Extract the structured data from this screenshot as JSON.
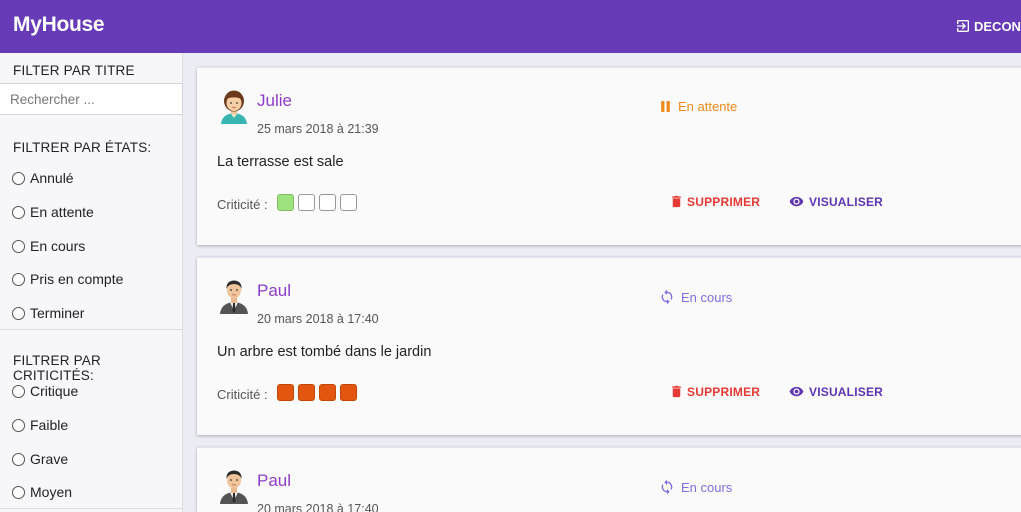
{
  "app": {
    "title": "MyHouse",
    "logout_label": "DECONNEXION"
  },
  "sidebar": {
    "filter_title_heading": "FILTER PAR TITRE",
    "search_placeholder": "Rechercher ...",
    "filter_states_heading": "FILTRER PAR ÉTATS:",
    "states": [
      "Annulé",
      "En attente",
      "En cours",
      "Pris en compte",
      "Terminer"
    ],
    "filter_criticity_heading": "FILTRER PAR CRITICITÉS:",
    "criticities": [
      "Critique",
      "Faible",
      "Grave",
      "Moyen"
    ]
  },
  "labels": {
    "criticity": "Criticité :",
    "delete": "SUPPRIMER",
    "view": "VISUALISER"
  },
  "colors": {
    "primary": "#673ab7",
    "author": "#8e3bc9",
    "status_waiting": "#ef8a1a",
    "status_in_progress": "#7e6ee0",
    "delete": "#e53935",
    "view": "#5e35b1",
    "crit_low": "#9ee27d",
    "crit_high": "#e2560f"
  },
  "tickets": [
    {
      "author": "Julie",
      "avatar": "woman-avatar-icon",
      "date": "25 mars 2018 à 21:39",
      "description": "La terrasse est sale",
      "status": "En attente",
      "status_icon": "pause-icon",
      "criticity_level": 1,
      "criticity_color": "green"
    },
    {
      "author": "Paul",
      "avatar": "man-avatar-icon",
      "date": "20 mars 2018 à 17:40",
      "description": "Un arbre est tombé dans le jardin",
      "status": "En cours",
      "status_icon": "sync-icon",
      "criticity_level": 4,
      "criticity_color": "orange"
    },
    {
      "author": "Paul",
      "avatar": "man-avatar-icon",
      "date": "20 mars 2018 à 17:40",
      "description": "",
      "status": "En cours",
      "status_icon": "sync-icon",
      "criticity_level": 0,
      "criticity_color": "orange"
    }
  ]
}
